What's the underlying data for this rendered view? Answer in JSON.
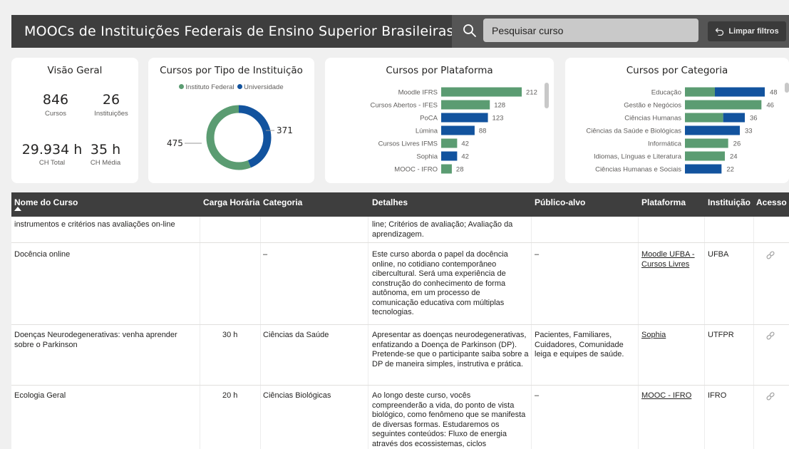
{
  "header": {
    "title": "MOOCs de Instituições Federais de Ensino Superior Brasileiras",
    "search_placeholder": "Pesquisar curso",
    "clear_filters_label": "Limpar filtros"
  },
  "overview": {
    "title": "Visão Geral",
    "courses_value": "846",
    "courses_label": "Cursos",
    "institutions_value": "26",
    "institutions_label": "Instituições",
    "total_hours_value": "29.934 h",
    "total_hours_label": "CH Total",
    "avg_hours_value": "35 h",
    "avg_hours_label": "CH Média"
  },
  "donut": {
    "title": "Cursos por Tipo de Instituição",
    "legend": [
      "Instituto Federal",
      "Universidade"
    ],
    "colors": [
      "#5b9c72",
      "#12539e"
    ],
    "labels": [
      "475",
      "371"
    ]
  },
  "platform_chart": {
    "title": "Cursos por Plataforma",
    "bar_color_green": "#5b9c72",
    "bar_color_blue": "#12539e"
  },
  "category_chart": {
    "title": "Cursos por Categoria"
  },
  "chart_data": [
    {
      "type": "pie",
      "title": "Cursos por Tipo de Instituição",
      "categories": [
        "Instituto Federal",
        "Universidade"
      ],
      "values": [
        475,
        371
      ],
      "legend": "top"
    },
    {
      "type": "bar",
      "orientation": "horizontal",
      "title": "Cursos por Plataforma",
      "categories": [
        "Moodle IFRS",
        "Cursos Abertos - IFES",
        "PoCA",
        "Lúmina",
        "Cursos Livres IFMS",
        "Sophia",
        "MOOC - IFRO"
      ],
      "values": [
        212,
        128,
        123,
        88,
        42,
        42,
        28
      ],
      "colors": [
        "#5b9c72",
        "#5b9c72",
        "#12539e",
        "#12539e",
        "#5b9c72",
        "#12539e",
        "#5b9c72"
      ],
      "xlim": [
        0,
        212
      ]
    },
    {
      "type": "bar",
      "orientation": "horizontal",
      "stacked": true,
      "title": "Cursos por Categoria",
      "categories": [
        "Educação",
        "Gestão e Negócios",
        "Ciências Humanas",
        "Ciências da Saúde e Biológicas",
        "Informática",
        "Idiomas, Línguas e Literatura",
        "Ciências Humanas e Sociais"
      ],
      "series": [
        {
          "name": "Instituto Federal",
          "values": [
            18,
            46,
            23,
            0,
            26,
            24,
            0
          ]
        },
        {
          "name": "Universidade",
          "values": [
            30,
            0,
            13,
            33,
            0,
            0,
            22
          ]
        }
      ],
      "totals": [
        48,
        46,
        36,
        33,
        26,
        24,
        22
      ],
      "xlim": [
        0,
        48
      ]
    }
  ],
  "table": {
    "headers": [
      "Nome do Curso",
      "Carga Horária",
      "Categoria",
      "Detalhes",
      "Público-alvo",
      "Plataforma",
      "Instituição",
      "Acesso"
    ],
    "rows": [
      {
        "name": "instrumentos e critérios nas avaliações on-line",
        "hours": "",
        "category": "",
        "details": "line; Critérios de avaliação; Avaliação da aprendizagem.",
        "audience": "",
        "platform": "",
        "institution": ""
      },
      {
        "name": "Docência online",
        "hours": "",
        "category": "–",
        "details": "Este curso aborda o papel da docência online, no cotidiano contemporâneo cibercultural. Será uma experiência de construção do conhecimento de forma autônoma, em um processo de comunicação educativa com múltiplas tecnologias.",
        "audience": "–",
        "platform": "Moodle UFBA - Cursos Livres",
        "institution": "UFBA"
      },
      {
        "name": "Doenças Neurodegenerativas: venha aprender sobre o Parkinson",
        "hours": "30 h",
        "category": "Ciências da Saúde",
        "details": "Apresentar as doenças neurodegenerativas, enfatizando a Doença de Parkinson (DP). Pretende-se que o participante saiba sobre a DP de maneira simples, instrutiva e prática.",
        "audience": "Pacientes, Familiares, Cuidadores, Comunidade leiga e equipes de saúde.",
        "platform": "Sophia",
        "institution": "UTFPR"
      },
      {
        "name": "Ecologia Geral",
        "hours": "20 h",
        "category": "Ciências Biológicas",
        "details": "Ao longo deste curso, vocês compreenderão a vida, do ponto de vista biológico, como fenômeno que se manifesta de diversas formas. Estudaremos os seguintes conteúdos: Fluxo de energia através dos ecossistemas, ciclos",
        "audience": "–",
        "platform": "MOOC - IFRO",
        "institution": "IFRO"
      }
    ]
  }
}
